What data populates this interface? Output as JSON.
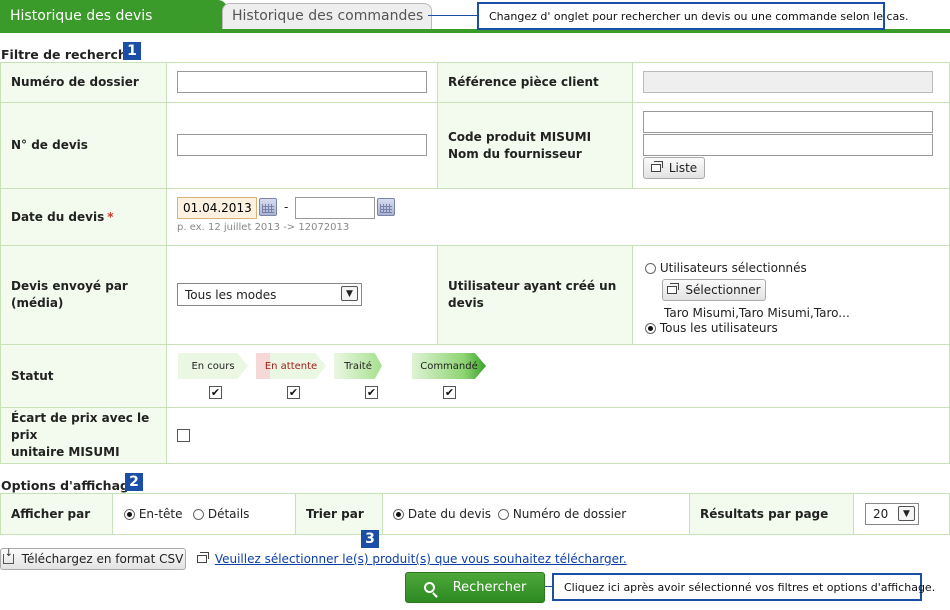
{
  "tabs": {
    "active": "Historique des devis",
    "inactive": "Historique des commandes"
  },
  "callouts": {
    "tabs": "Changez d' onglet pour rechercher un devis ou une commande selon le cas.",
    "search": "Cliquez ici après avoir sélectionné vos filtres et options d'affichage."
  },
  "filter": {
    "title": "Filtre de recherche",
    "badge": "1",
    "file_number_label": "Numéro de dossier",
    "file_number_value": "",
    "customer_ref_label": "Référence pièce client",
    "customer_ref_value": "",
    "quote_no_label": "N° de devis",
    "quote_no_value": "",
    "product_code_label_1": "Code produit MISUMI",
    "product_code_label_2": "Nom du fournisseur",
    "product_code_value": "",
    "supplier_value": "",
    "list_button": "Liste",
    "date_label": "Date du devis",
    "date_required": "*",
    "date_from": "01.04.2013",
    "date_to": "",
    "date_separator": "-",
    "date_hint": "p. ex. 12 juillet 2013 -> 12072013",
    "media_label": "Devis envoyé par (média)",
    "media_value": "Tous les modes",
    "creator_label": "Utilisateur ayant créé un devis",
    "creator_selected_option": "Utilisateurs sélectionnés",
    "creator_select_button": "Sélectionner",
    "creator_selected_users": "Taro Misumi,Taro Misumi,Taro...",
    "creator_all_option": "Tous les utilisateurs",
    "status_label": "Statut",
    "status_items": [
      {
        "label": "En cours",
        "checked": "✔"
      },
      {
        "label": "En attente",
        "checked": "✔"
      },
      {
        "label": "Traité",
        "checked": "✔"
      },
      {
        "label": "Commandé",
        "checked": "✔"
      }
    ],
    "price_diff_label_1": "Écart de prix avec le prix",
    "price_diff_label_2": "unitaire MISUMI"
  },
  "display": {
    "title": "Options d'affichage",
    "badge": "2",
    "show_by_label": "Afficher par",
    "show_header": "En-tête",
    "show_details": "Détails",
    "sort_label": "Trier par",
    "sort_date": "Date du devis",
    "sort_file": "Numéro de dossier",
    "per_page_label": "Résultats par page",
    "per_page_value": "20"
  },
  "footer": {
    "badge": "3",
    "csv_button": "Téléchargez en format CSV",
    "select_link": "Veuillez sélectionner le(s) produit(s) que vous souhaitez télécharger.",
    "search_button": "Rechercher"
  },
  "colors": {
    "accent_green": "#3a9a2a",
    "callout_blue": "#1b4ea6"
  }
}
